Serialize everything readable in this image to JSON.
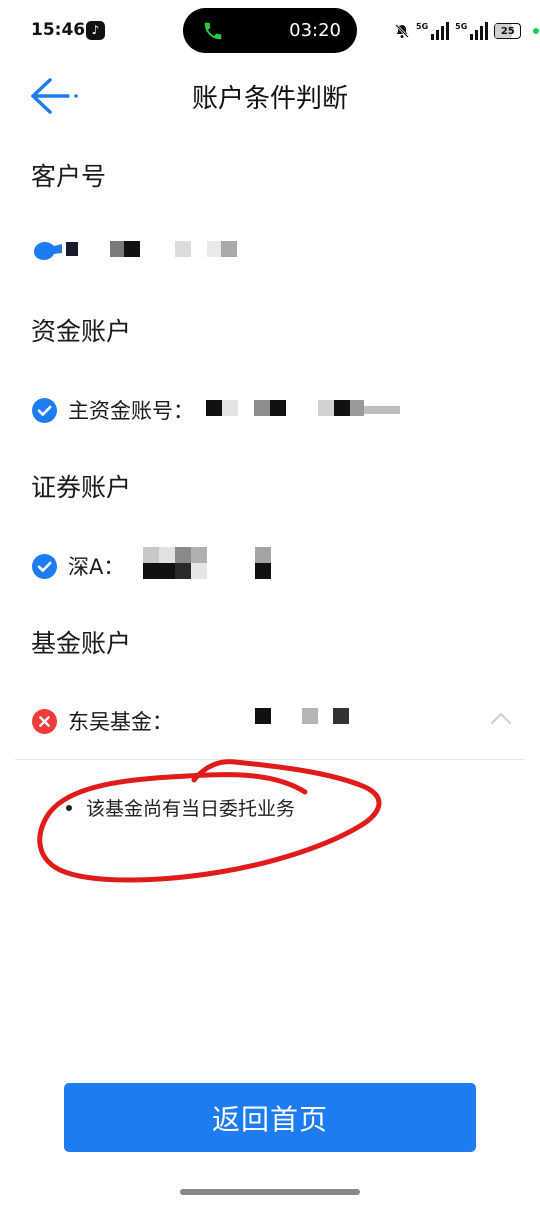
{
  "status_bar": {
    "time": "15:46",
    "call_time": "03:20",
    "network_1": "5G",
    "network_2": "5G",
    "battery": "25"
  },
  "header": {
    "title": "账户条件判断"
  },
  "customer": {
    "heading": "客户号"
  },
  "fund_account": {
    "heading": "资金账户",
    "main_label": "主资金账号："
  },
  "securities_account": {
    "heading": "证券账户",
    "shen_label": "深A："
  },
  "fund_company_account": {
    "heading": "基金账户",
    "dongwu_label": "东吴基金："
  },
  "message": {
    "text": "该基金尚有当日委托业务"
  },
  "footer": {
    "return_button": "返回首页"
  },
  "colors": {
    "accent": "#1e7cf2",
    "error": "#ef3b3b",
    "annotation": "#e11a1a"
  }
}
